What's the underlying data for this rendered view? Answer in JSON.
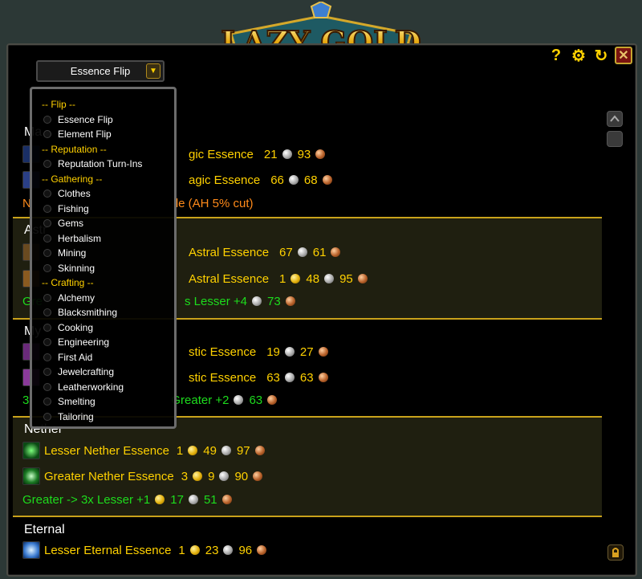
{
  "app": {
    "logo_text": "LAZY GOLD",
    "help_label": "?"
  },
  "dropdown": {
    "selected": "Essence Flip"
  },
  "menu": {
    "items": [
      {
        "kind": "cat",
        "label": "-- Flip --"
      },
      {
        "kind": "opt",
        "label": "Essence Flip"
      },
      {
        "kind": "opt",
        "label": "Element Flip"
      },
      {
        "kind": "cat",
        "label": "-- Reputation --"
      },
      {
        "kind": "opt",
        "label": "Reputation Turn-Ins"
      },
      {
        "kind": "cat",
        "label": "-- Gathering --"
      },
      {
        "kind": "opt",
        "label": "Clothes"
      },
      {
        "kind": "opt",
        "label": "Fishing"
      },
      {
        "kind": "opt",
        "label": "Gems"
      },
      {
        "kind": "opt",
        "label": "Herbalism"
      },
      {
        "kind": "opt",
        "label": "Mining"
      },
      {
        "kind": "opt",
        "label": "Skinning"
      },
      {
        "kind": "cat",
        "label": "-- Crafting --"
      },
      {
        "kind": "opt",
        "label": "Alchemy"
      },
      {
        "kind": "opt",
        "label": "Blacksmithing"
      },
      {
        "kind": "opt",
        "label": "Cooking"
      },
      {
        "kind": "opt",
        "label": "Engineering"
      },
      {
        "kind": "opt",
        "label": "First Aid"
      },
      {
        "kind": "opt",
        "label": "Jewelcrafting"
      },
      {
        "kind": "opt",
        "label": "Leatherworking"
      },
      {
        "kind": "opt",
        "label": "Smelting"
      },
      {
        "kind": "opt",
        "label": "Tailoring"
      }
    ]
  },
  "partial": {
    "magic_head": "Ma",
    "magic_r1": "gic Essence",
    "magic_r1_s": "21",
    "magic_r1_c": "93",
    "magic_r2": "agic Essence",
    "magic_r2_s": "66",
    "magic_r2_c": "68",
    "magic_note": "le (AH 5% cut)",
    "magic_note_prefix": "N",
    "astral_head": "Astr",
    "astral_r1": "Astral Essence",
    "astral_r1_s": "67",
    "astral_r1_c": "61",
    "astral_r2": "Astral Essence",
    "astral_r2_g": "1",
    "astral_r2_s": "48",
    "astral_r2_c": "95",
    "astral_g_prefix": "Gre",
    "astral_g_mid": "s Lesser +4",
    "astral_g_c": "73",
    "mystic_head": "My",
    "mystic_r1": "stic Essence",
    "mystic_r1_s": "19",
    "mystic_r1_c": "27",
    "mystic_r2": "stic Essence",
    "mystic_r2_s": "63",
    "mystic_r2_c": "63",
    "mystic_g_prefix": "3",
    "mystic_g_mid": "Greater +2",
    "mystic_g_c": "63",
    "nether_head": "Nether"
  },
  "nether": {
    "lesser": {
      "name": "Lesser Nether Essence",
      "g": "1",
      "s": "49",
      "c": "97"
    },
    "greater": {
      "name": "Greater Nether Essence",
      "g": "3",
      "s": "9",
      "c": "90"
    },
    "flip": {
      "text": "Greater -> 3x Lesser +1",
      "s": "17",
      "c": "51"
    }
  },
  "eternal": {
    "head": "Eternal",
    "lesser": {
      "name": "Lesser Eternal Essence",
      "g": "1",
      "s": "23",
      "c": "96"
    }
  },
  "colors": {
    "gold_text": "#ffd100",
    "profit_green": "#1ddc1d",
    "separator": "#c9a21b",
    "panel_bg": "#000000"
  }
}
